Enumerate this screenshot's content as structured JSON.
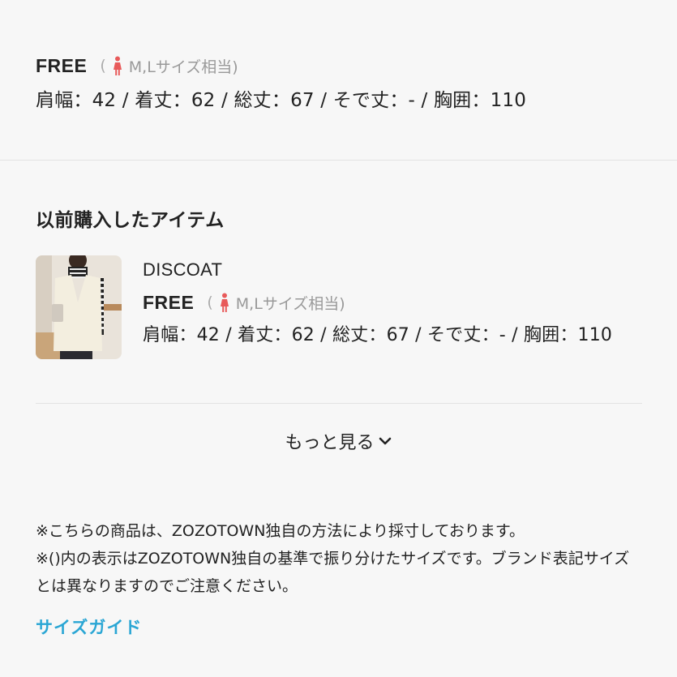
{
  "current_size": {
    "name": "FREE",
    "equivalent_open": "(",
    "equivalent": "M,Lサイズ相当)",
    "measurements": "肩幅：42 / 着丈：62 / 総丈：67 / そで丈：- / 胸囲：110"
  },
  "purchased": {
    "title": "以前購入したアイテム",
    "items": [
      {
        "brand": "DISCOAT",
        "size": "FREE",
        "equivalent_open": "(",
        "equivalent": "M,Lサイズ相当)",
        "measurements": "肩幅：42 / 着丈：62 / 総丈：67 / そで丈：- / 胸囲：110"
      }
    ],
    "more_label": "もっと見る"
  },
  "notes": [
    "※こちらの商品は、ZOZOTOWN独自の方法により採寸しております。",
    "※()内の表示はZOZOTOWN独自の基準で振り分けたサイズです。ブランド表記サイズとは異なりますのでご注意ください。"
  ],
  "size_guide_label": "サイズガイド",
  "colors": {
    "link": "#2aa6d4",
    "person_icon": "#e85a5a",
    "background": "#f7f7f7"
  },
  "icons": {
    "person": "woman-figure-icon",
    "chevron": "chevron-down-icon"
  }
}
